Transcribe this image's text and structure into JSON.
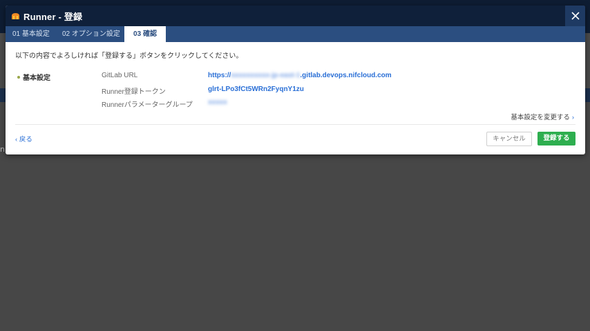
{
  "background": {
    "side_text": "n"
  },
  "modal": {
    "title": "Runner - 登録",
    "tabs": [
      {
        "label": "01 基本設定"
      },
      {
        "label": "02 オプション設定"
      },
      {
        "label": "03 確認"
      }
    ],
    "active_tab": 2,
    "intro": "以下の内容でよろしければ「登録する」ボタンをクリックしてください。",
    "section_title": "基本設定",
    "rows": [
      {
        "label": "GitLab URL",
        "value_prefix": "https://",
        "value_blurred": "xxxxxxxxxx-jp-east-1",
        "value_suffix": ".gitlab.devops.nifcloud.com"
      },
      {
        "label": "Runner登録トークン",
        "value_prefix": "glrt-LPo3fCt5WRn2FyqnY1zu",
        "value_blurred": "",
        "value_suffix": ""
      },
      {
        "label": "Runnerパラメーターグループ",
        "value_prefix": "",
        "value_blurred": "xxxxx",
        "value_suffix": ""
      }
    ],
    "change_link": "基本設定を変更する",
    "back_link": "戻る",
    "cancel_label": "キャンセル",
    "register_label": "登録する"
  },
  "colors": {
    "titlebar": "#0f203a",
    "tabbar": "#2b4e80",
    "link": "#2a6fd6",
    "register_button": "#2eae4f"
  }
}
